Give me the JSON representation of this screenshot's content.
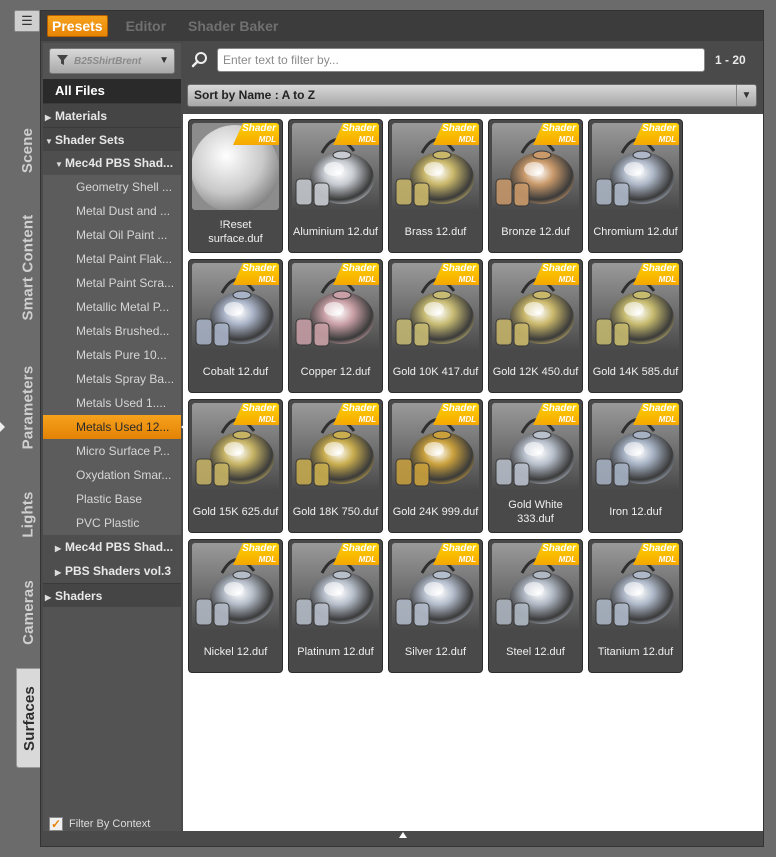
{
  "top_tabs": [
    {
      "label": "Presets",
      "active": true
    },
    {
      "label": "Editor",
      "active": false
    },
    {
      "label": "Shader Baker",
      "active": false
    }
  ],
  "side_tabs": [
    {
      "label": "Scene"
    },
    {
      "label": "Smart Content"
    },
    {
      "label": "Parameters"
    },
    {
      "label": "Lights"
    },
    {
      "label": "Cameras"
    },
    {
      "label": "Surfaces",
      "active": true
    }
  ],
  "sidebar": {
    "path_value": "B25ShirtBrent",
    "tree": [
      {
        "label": "All Files",
        "level": "root"
      },
      {
        "label": "Materials",
        "level": "lvl0",
        "expanded": false
      },
      {
        "label": "Shader Sets",
        "level": "lvl0",
        "expanded": true
      },
      {
        "label": "Mec4d PBS Shad...",
        "level": "lvl1",
        "expanded": true
      },
      {
        "label": "Geometry Shell ...",
        "level": "lvl2"
      },
      {
        "label": "Metal Dust and ...",
        "level": "lvl2"
      },
      {
        "label": "Metal Oil Paint ...",
        "level": "lvl2"
      },
      {
        "label": "Metal Paint Flak...",
        "level": "lvl2"
      },
      {
        "label": "Metal Paint Scra...",
        "level": "lvl2"
      },
      {
        "label": "Metallic Metal P...",
        "level": "lvl2"
      },
      {
        "label": "Metals Brushed...",
        "level": "lvl2"
      },
      {
        "label": "Metals Pure 10...",
        "level": "lvl2"
      },
      {
        "label": "Metals Spray Ba...",
        "level": "lvl2"
      },
      {
        "label": "Metals Used 1....",
        "level": "lvl2"
      },
      {
        "label": "Metals Used 12...",
        "level": "lvl2",
        "selected": true
      },
      {
        "label": "Micro Surface P...",
        "level": "lvl2"
      },
      {
        "label": "Oxydation Smar...",
        "level": "lvl2"
      },
      {
        "label": "Plastic Base",
        "level": "lvl2"
      },
      {
        "label": "PVC Plastic",
        "level": "lvl2"
      },
      {
        "label": "Mec4d PBS Shad...",
        "level": "lvl1",
        "expanded": false
      },
      {
        "label": "PBS Shaders vol.3",
        "level": "lvl1",
        "expanded": false
      },
      {
        "label": "Shaders",
        "level": "lvl0",
        "expanded": false
      }
    ],
    "filter_by_context": {
      "label": "Filter By Context",
      "checked": true
    }
  },
  "search": {
    "placeholder": "Enter text to filter by...",
    "value": ""
  },
  "page_range": "1 - 20",
  "sort": {
    "selected": "Sort by Name : A to Z"
  },
  "badge": {
    "line1": "Shader",
    "line2": "MDL"
  },
  "colors": {
    "accent": "#f39a12",
    "badge": "#ffc400"
  },
  "presets": [
    {
      "label": "!Reset surface.duf",
      "kind": "sphere",
      "tint": "#b8b8b8"
    },
    {
      "label": "Aluminium 12.duf",
      "kind": "kettle",
      "tint": "#c8ccd2"
    },
    {
      "label": "Brass 12.duf",
      "kind": "kettle",
      "tint": "#c9b76a"
    },
    {
      "label": "Bronze 12.duf",
      "kind": "kettle",
      "tint": "#c9996a"
    },
    {
      "label": "Chromium 12.duf",
      "kind": "kettle",
      "tint": "#aeb8c8"
    },
    {
      "label": "Cobalt 12.duf",
      "kind": "kettle",
      "tint": "#a9b3c7"
    },
    {
      "label": "Copper 12.duf",
      "kind": "kettle",
      "tint": "#c9a0a6"
    },
    {
      "label": "Gold 10K 417.duf",
      "kind": "kettle",
      "tint": "#c7bb73"
    },
    {
      "label": "Gold 12K 450.duf",
      "kind": "kettle",
      "tint": "#c9b76a"
    },
    {
      "label": "Gold 14K 585.duf",
      "kind": "kettle",
      "tint": "#c6ba6e"
    },
    {
      "label": "Gold 15K 625.duf",
      "kind": "kettle",
      "tint": "#c6b364"
    },
    {
      "label": "Gold 18K 750.duf",
      "kind": "kettle",
      "tint": "#c9ad4e"
    },
    {
      "label": "Gold 24K 999.duf",
      "kind": "kettle",
      "tint": "#c9a03c"
    },
    {
      "label": "Gold White 333.duf",
      "kind": "kettle",
      "tint": "#b8c0cc"
    },
    {
      "label": "Iron 12.duf",
      "kind": "kettle",
      "tint": "#a6b2c4"
    },
    {
      "label": "Nickel 12.duf",
      "kind": "kettle",
      "tint": "#b4bcc8"
    },
    {
      "label": "Platinum 12.duf",
      "kind": "kettle",
      "tint": "#b7bfcb"
    },
    {
      "label": "Silver 12.duf",
      "kind": "kettle",
      "tint": "#b4bdcc"
    },
    {
      "label": "Steel 12.duf",
      "kind": "kettle",
      "tint": "#b0b8c4"
    },
    {
      "label": "Titanium 12.duf",
      "kind": "kettle",
      "tint": "#aeb8c8"
    }
  ]
}
